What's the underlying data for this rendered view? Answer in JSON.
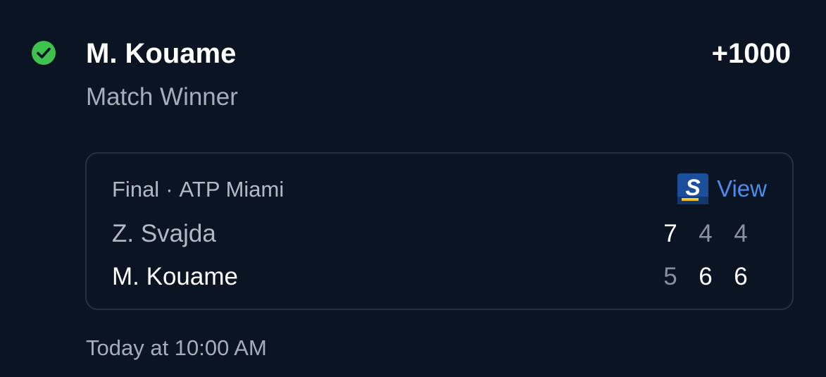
{
  "bet": {
    "status_icon": "check-circle-icon",
    "status_color": "#3fc24d",
    "selection": "M. Kouame",
    "odds": "+1000",
    "market": "Match Winner",
    "time": "Today at 10:00 AM"
  },
  "scoreboard": {
    "status": "Final",
    "separator": "·",
    "event": "ATP Miami",
    "view_icon": "score-app-logo-icon",
    "view_label": "View",
    "link_color": "#4d8ce8",
    "players": [
      {
        "name": "Z. Svajda",
        "sets": [
          "7",
          "4",
          "4"
        ],
        "set_won": [
          true,
          false,
          false
        ]
      },
      {
        "name": "M. Kouame",
        "sets": [
          "5",
          "6",
          "6"
        ],
        "set_won": [
          false,
          true,
          true
        ]
      }
    ]
  }
}
